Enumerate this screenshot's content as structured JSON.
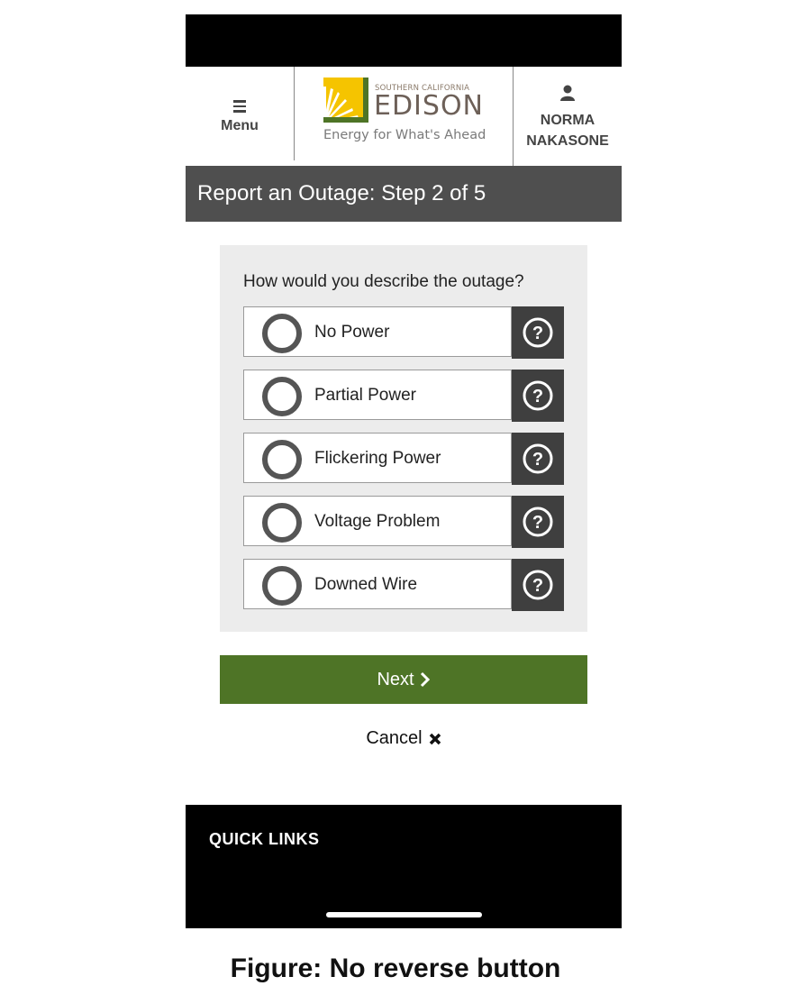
{
  "header": {
    "menu_label": "Menu",
    "logo": {
      "subtitle": "SOUTHERN CALIFORNIA",
      "brand": "EDISON",
      "tagline": "Energy for What's Ahead"
    },
    "user_name_line1": "NORMA",
    "user_name_line2": "NAKASONE"
  },
  "step_title": "Report an Outage: Step 2 of 5",
  "form": {
    "question": "How would you describe the outage?",
    "options": [
      {
        "label": "No Power",
        "selected": false
      },
      {
        "label": "Partial Power",
        "selected": false
      },
      {
        "label": "Flickering Power",
        "selected": false
      },
      {
        "label": "Voltage Problem",
        "selected": false
      },
      {
        "label": "Downed Wire",
        "selected": false
      }
    ]
  },
  "actions": {
    "next_label": "Next",
    "cancel_label": "Cancel"
  },
  "footer": {
    "title": "QUICK LINKS"
  },
  "caption": "Figure: No reverse button",
  "colors": {
    "step_bar": "#4f4f4f",
    "next_button": "#4e7426",
    "help_button": "#3f3f3f",
    "logo_yellow": "#f5c400",
    "logo_green": "#4e7426"
  }
}
